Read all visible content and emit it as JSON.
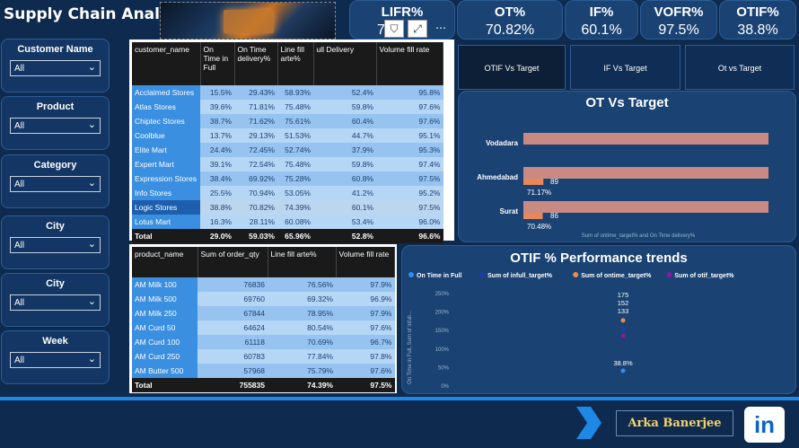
{
  "header": {
    "title": "Supply Chain Analysis",
    "kpis": [
      {
        "label": "LIFR%",
        "value": "7"
      },
      {
        "label": "OT%",
        "value": "70.82%"
      },
      {
        "label": "IF%",
        "value": "60.1%"
      },
      {
        "label": "VOFR%",
        "value": "97.5%"
      },
      {
        "label": "OTIF%",
        "value": "38.8%"
      }
    ],
    "visual_icons": [
      "filter-icon",
      "focus-mode-icon",
      "more-options-icon"
    ],
    "icon_glyphs": {
      "filter": "⛉",
      "focus": "⤢",
      "more": "⋯"
    }
  },
  "filters": [
    {
      "label": "Customer Name",
      "value": "All"
    },
    {
      "label": "Product",
      "value": "All"
    },
    {
      "label": "Category",
      "value": "All"
    },
    {
      "label": "City",
      "value": "All"
    },
    {
      "label": "City",
      "value": "All"
    },
    {
      "label": "Week",
      "value": "All"
    }
  ],
  "customer_table": {
    "columns": [
      "customer_name",
      "On Time in Full",
      "On Time delivery%",
      "Line fill arte%",
      "ull Delivery",
      "Volume fill rate"
    ],
    "rows": [
      [
        "Acclaimed Stores",
        "15.5%",
        "29.43%",
        "58.93%",
        "52.4%",
        "95.8%"
      ],
      [
        "Atlas Stores",
        "39.6%",
        "71.81%",
        "75.48%",
        "59.8%",
        "97.6%"
      ],
      [
        "Chiptec Stores",
        "38.7%",
        "71.62%",
        "75.61%",
        "60.4%",
        "97.6%"
      ],
      [
        "Coolblue",
        "13.7%",
        "29.13%",
        "51.53%",
        "44.7%",
        "95.1%"
      ],
      [
        "Elite Mart",
        "24.4%",
        "72.45%",
        "52.74%",
        "37.9%",
        "95.3%"
      ],
      [
        "Expert Mart",
        "39.1%",
        "72.54%",
        "75.48%",
        "59.8%",
        "97.4%"
      ],
      [
        "Expression Stores",
        "38.4%",
        "69.92%",
        "75.28%",
        "60.8%",
        "97.5%"
      ],
      [
        "Info Stores",
        "25.5%",
        "70.94%",
        "53.05%",
        "41.2%",
        "95.2%"
      ],
      [
        "Logic Stores",
        "38.8%",
        "70.82%",
        "74.39%",
        "60.1%",
        "97.5%"
      ],
      [
        "Lotus Mart",
        "16.3%",
        "28.11%",
        "60.08%",
        "53.4%",
        "96.0%"
      ]
    ],
    "total": [
      "Total",
      "29.0%",
      "59.03%",
      "65.96%",
      "52.8%",
      "96.6%"
    ]
  },
  "product_table": {
    "columns": [
      "product_name",
      "Sum of order_qty",
      "Line fill arte%",
      "Volume fill rate"
    ],
    "rows": [
      [
        "AM Milk 100",
        "76836",
        "76.56%",
        "97.9%"
      ],
      [
        "AM Milk 500",
        "69760",
        "69.32%",
        "96.9%"
      ],
      [
        "AM Milk 250",
        "67844",
        "78.95%",
        "97.9%"
      ],
      [
        "AM Curd 50",
        "64624",
        "80.54%",
        "97.6%"
      ],
      [
        "AM Curd 100",
        "61118",
        "70.69%",
        "96.7%"
      ],
      [
        "AM Curd 250",
        "60783",
        "77.84%",
        "97.8%"
      ],
      [
        "AM Butter 500",
        "57968",
        "75.79%",
        "97.6%"
      ]
    ],
    "total": [
      "Total",
      "755835",
      "74.39%",
      "97.5%"
    ]
  },
  "tabs": [
    "OTIF Vs Target",
    "IF Vs Target",
    "Ot vs Target"
  ],
  "chart_data": [
    {
      "type": "bar",
      "title": "OT Vs Target",
      "categories": [
        "Vodadara",
        "Ahmedabad",
        "Surat"
      ],
      "series": [
        {
          "name": "Sum of ontime_target%",
          "values": [
            null,
            89,
            86
          ]
        },
        {
          "name": "On Time delivery%",
          "values": [
            null,
            71.17,
            70.48
          ]
        }
      ],
      "value_labels": {
        "target": [
          "",
          "89",
          "86"
        ],
        "actual": [
          "",
          "71.17%",
          "70.48%"
        ]
      },
      "xlabel": "Sum of ontime_target% and On Time delivery%",
      "colors": {
        "target": "#e8875a",
        "bar_bg": "#c98a84"
      }
    },
    {
      "type": "scatter",
      "title": "OTIF % Performance trends",
      "legend": [
        "On Time in Full",
        "Sum of infull_target%",
        "Sum of ontime_target%",
        "Sum of otif_target%"
      ],
      "legend_colors": [
        "#2f8ff0",
        "#1c3ea8",
        "#f08a4a",
        "#8a1a9a"
      ],
      "points": [
        {
          "series": "Sum of ontime_target%",
          "value": 175,
          "label": "175"
        },
        {
          "series": "Sum of infull_target%",
          "value": 152,
          "label": "152"
        },
        {
          "series": "Sum of otif_target%",
          "value": 133,
          "label": "133"
        },
        {
          "series": "On Time in Full",
          "value": 0.388,
          "label": "38.8%"
        }
      ],
      "ylabel": "On Time in Full, Sum of infull...",
      "y_ticks": [
        "250%",
        "200%",
        "150%",
        "100%",
        "50%",
        "0%"
      ]
    }
  ],
  "footer": {
    "author": "Arka Banerjee",
    "linkedin_text": "in"
  }
}
